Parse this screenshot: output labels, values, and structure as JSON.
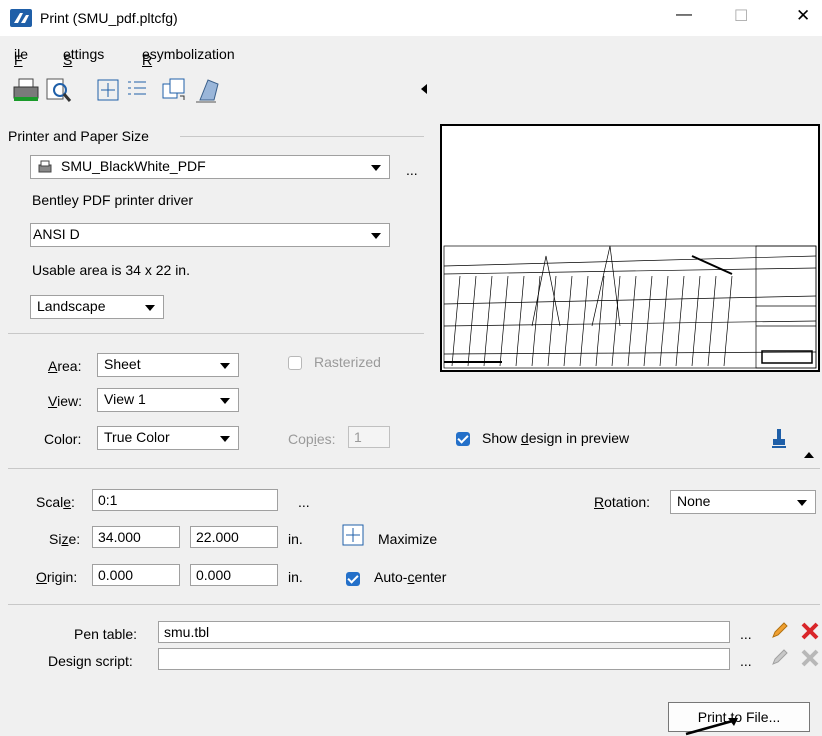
{
  "window": {
    "title": "Print  (SMU_pdf.pltcfg)",
    "minimize": "—",
    "maximize": "☐",
    "close": "✕"
  },
  "menu": {
    "file": "File",
    "settings": "Settings",
    "resymbolization": "Resymbolization"
  },
  "toolbar": {
    "icons": [
      "printer-icon",
      "preview-icon",
      "fit-icon",
      "list-icon",
      "page-icon",
      "print-organizer-icon"
    ]
  },
  "printer": {
    "section_label": "Printer and Paper Size",
    "printer_name": "SMU_BlackWhite_PDF",
    "more": "...",
    "driver": "Bentley PDF printer driver",
    "paper_size": "ANSI D",
    "usable_area": "Usable area is 34 x 22 in.",
    "orientation": "Landscape"
  },
  "area": {
    "area_label": "Area:",
    "area_value": "Sheet",
    "view_label": "View:",
    "view_value": "View 1",
    "color_label": "Color:",
    "color_value": "True Color",
    "rasterized": "Rasterized",
    "rasterized_checked": false,
    "copies_label": "Copies:",
    "copies_value": "1",
    "show_design": "Show design in preview",
    "show_design_checked": true
  },
  "scale": {
    "scale_label": "Scale:",
    "scale_value": "0:1",
    "more": "...",
    "rotation_label": "Rotation:",
    "rotation_value": "None",
    "size_label": "Size:",
    "size_w": "34.000",
    "size_h": "22.000",
    "size_unit": "in.",
    "maximize": "Maximize",
    "origin_label": "Origin:",
    "origin_x": "0.000",
    "origin_y": "0.000",
    "origin_unit": "in.",
    "auto_center": "Auto-center",
    "auto_center_checked": true
  },
  "pen": {
    "pen_table_label": "Pen table:",
    "pen_table_value": "smu.tbl",
    "design_script_label": "Design script:",
    "design_script_value": "",
    "more": "..."
  },
  "actions": {
    "print_to_file": "Print to File..."
  },
  "colors": {
    "accent": "#2470c9",
    "delete": "#d9262a",
    "edit": "#f0a030"
  }
}
